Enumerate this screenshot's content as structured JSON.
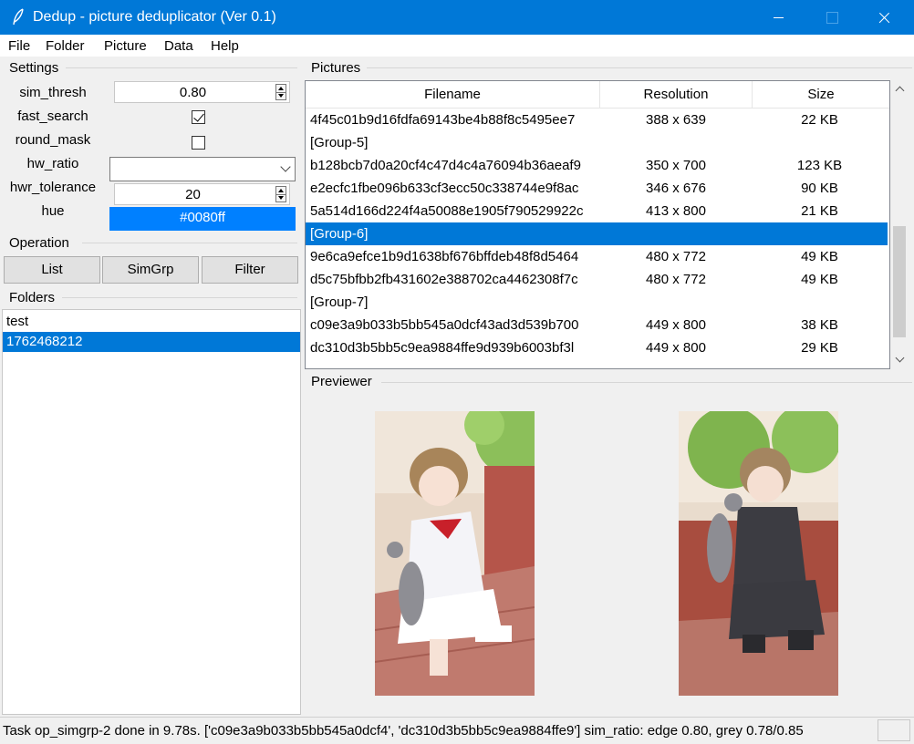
{
  "window": {
    "title": "Dedup - picture deduplicator (Ver 0.1)"
  },
  "menu": [
    "File",
    "Folder",
    "Picture",
    "Data",
    "Help"
  ],
  "settings": {
    "frame_label": "Settings",
    "sim_thresh_label": "sim_thresh",
    "sim_thresh_value": "0.80",
    "fast_search_label": "fast_search",
    "fast_search_checked": true,
    "round_mask_label": "round_mask",
    "round_mask_checked": false,
    "hw_ratio_label": "hw_ratio",
    "hw_ratio_value": "",
    "hwr_tolerance_label": "hwr_tolerance",
    "hwr_tolerance_value": "20",
    "hue_label": "hue",
    "hue_value": "#0080ff"
  },
  "operation": {
    "frame_label": "Operation",
    "list_label": "List",
    "simgrp_label": "SimGrp",
    "filter_label": "Filter"
  },
  "folders": {
    "frame_label": "Folders",
    "items": [
      "test",
      "1762468212"
    ],
    "selected_index": 1
  },
  "pictures": {
    "frame_label": "Pictures",
    "columns": [
      "Filename",
      "Resolution",
      "Size"
    ],
    "rows": [
      {
        "filename": "4f45c01b9d16fdfa69143be4b88f8c5495ee7",
        "resolution": "388 x 639",
        "size": "22 KB"
      },
      {
        "filename": "[Group-5]",
        "resolution": "",
        "size": ""
      },
      {
        "filename": "b128bcb7d0a20cf4c47d4c4a76094b36aeaf9",
        "resolution": "350 x 700",
        "size": "123 KB"
      },
      {
        "filename": "e2ecfc1fbe096b633cf3ecc50c338744e9f8ac",
        "resolution": "346 x 676",
        "size": "90 KB"
      },
      {
        "filename": "5a514d166d224f4a50088e1905f790529922c",
        "resolution": "413 x 800",
        "size": "21 KB"
      },
      {
        "filename": "[Group-6]",
        "resolution": "",
        "size": ""
      },
      {
        "filename": "9e6ca9efce1b9d1638bf676bffdeb48f8d5464",
        "resolution": "480 x 772",
        "size": "49 KB"
      },
      {
        "filename": "d5c75bfbb2fb431602e388702ca4462308f7c",
        "resolution": "480 x 772",
        "size": "49 KB"
      },
      {
        "filename": "[Group-7]",
        "resolution": "",
        "size": ""
      },
      {
        "filename": "c09e3a9b033b5bb545a0dcf43ad3d539b700",
        "resolution": "449 x 800",
        "size": "38 KB"
      },
      {
        "filename": "dc310d3b5bb5c9ea9884ffe9d939b6003bf3l",
        "resolution": "449 x 800",
        "size": "29 KB"
      }
    ],
    "selected_index": 5
  },
  "previewer": {
    "frame_label": "Previewer",
    "images": [
      "anime-girl-sailor-uniform-with-cat",
      "anime-boy-black-uniform-with-cat"
    ]
  },
  "status": {
    "text": "Task op_simgrp-2 done in 9.78s. ['c09e3a9b033b5bb545a0dcf4', 'dc310d3b5bb5c9ea9884ffe9'] sim_ratio: edge 0.80, grey 0.78/0.85"
  },
  "colors": {
    "titlebar": "#0078d7",
    "selection": "#0078d7",
    "hue_swatch": "#0080ff"
  }
}
